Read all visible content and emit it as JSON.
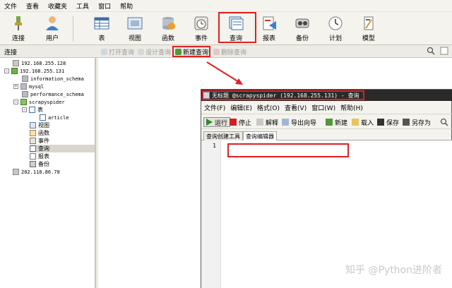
{
  "menubar": [
    "文件",
    "查看",
    "收藏夹",
    "工具",
    "窗口",
    "帮助"
  ],
  "toolbar": [
    {
      "label": "连接",
      "icon": "plug-icon"
    },
    {
      "label": "用户",
      "icon": "user-icon"
    },
    {
      "label": "表",
      "icon": "table-icon"
    },
    {
      "label": "视图",
      "icon": "view-icon"
    },
    {
      "label": "函数",
      "icon": "function-icon"
    },
    {
      "label": "事件",
      "icon": "clock-icon"
    },
    {
      "label": "查询",
      "icon": "query-icon"
    },
    {
      "label": "报表",
      "icon": "report-icon"
    },
    {
      "label": "备份",
      "icon": "backup-icon"
    },
    {
      "label": "计划",
      "icon": "schedule-icon"
    },
    {
      "label": "模型",
      "icon": "model-icon"
    }
  ],
  "subbar": {
    "title": "连接",
    "open_query": "打开查询",
    "design_query": "设计查询",
    "new_query": "新建查询",
    "delete_query": "删除查询"
  },
  "tree": [
    {
      "label": "192.168.255.128",
      "level": 0
    },
    {
      "label": "192.168.255.131",
      "level": 0
    },
    {
      "label": "information_schema",
      "level": 1
    },
    {
      "label": "mysql",
      "level": 1
    },
    {
      "label": "performance_schema",
      "level": 1
    },
    {
      "label": "scrapyspider",
      "level": 1
    },
    {
      "label": "表",
      "level": 2
    },
    {
      "label": "article",
      "level": 3
    },
    {
      "label": "视图",
      "level": 2
    },
    {
      "label": "函数",
      "level": 2
    },
    {
      "label": "事件",
      "level": 2
    },
    {
      "label": "查询",
      "level": 2
    },
    {
      "label": "报表",
      "level": 2
    },
    {
      "label": "备份",
      "level": 2
    },
    {
      "label": "202.118.86.78",
      "level": 0
    }
  ],
  "query_window": {
    "title": "无标题 @scrapyspider (192.168.255.131) - 查询",
    "menu": [
      "文件(F)",
      "编辑(E)",
      "格式(O)",
      "查看(V)",
      "窗口(W)",
      "帮助(H)"
    ],
    "tools": {
      "run": "运行",
      "stop": "停止",
      "explain": "解释",
      "export": "导出向导",
      "new": "新建",
      "load": "载入",
      "save": "保存",
      "save_as": "另存为"
    },
    "tabs": [
      "查询创建工具",
      "查询编辑器"
    ],
    "line_number": "1"
  },
  "watermark": "知乎 @Python进阶者",
  "colors": {
    "highlight": "#e02020",
    "title_bar": "#2a2a2a"
  }
}
